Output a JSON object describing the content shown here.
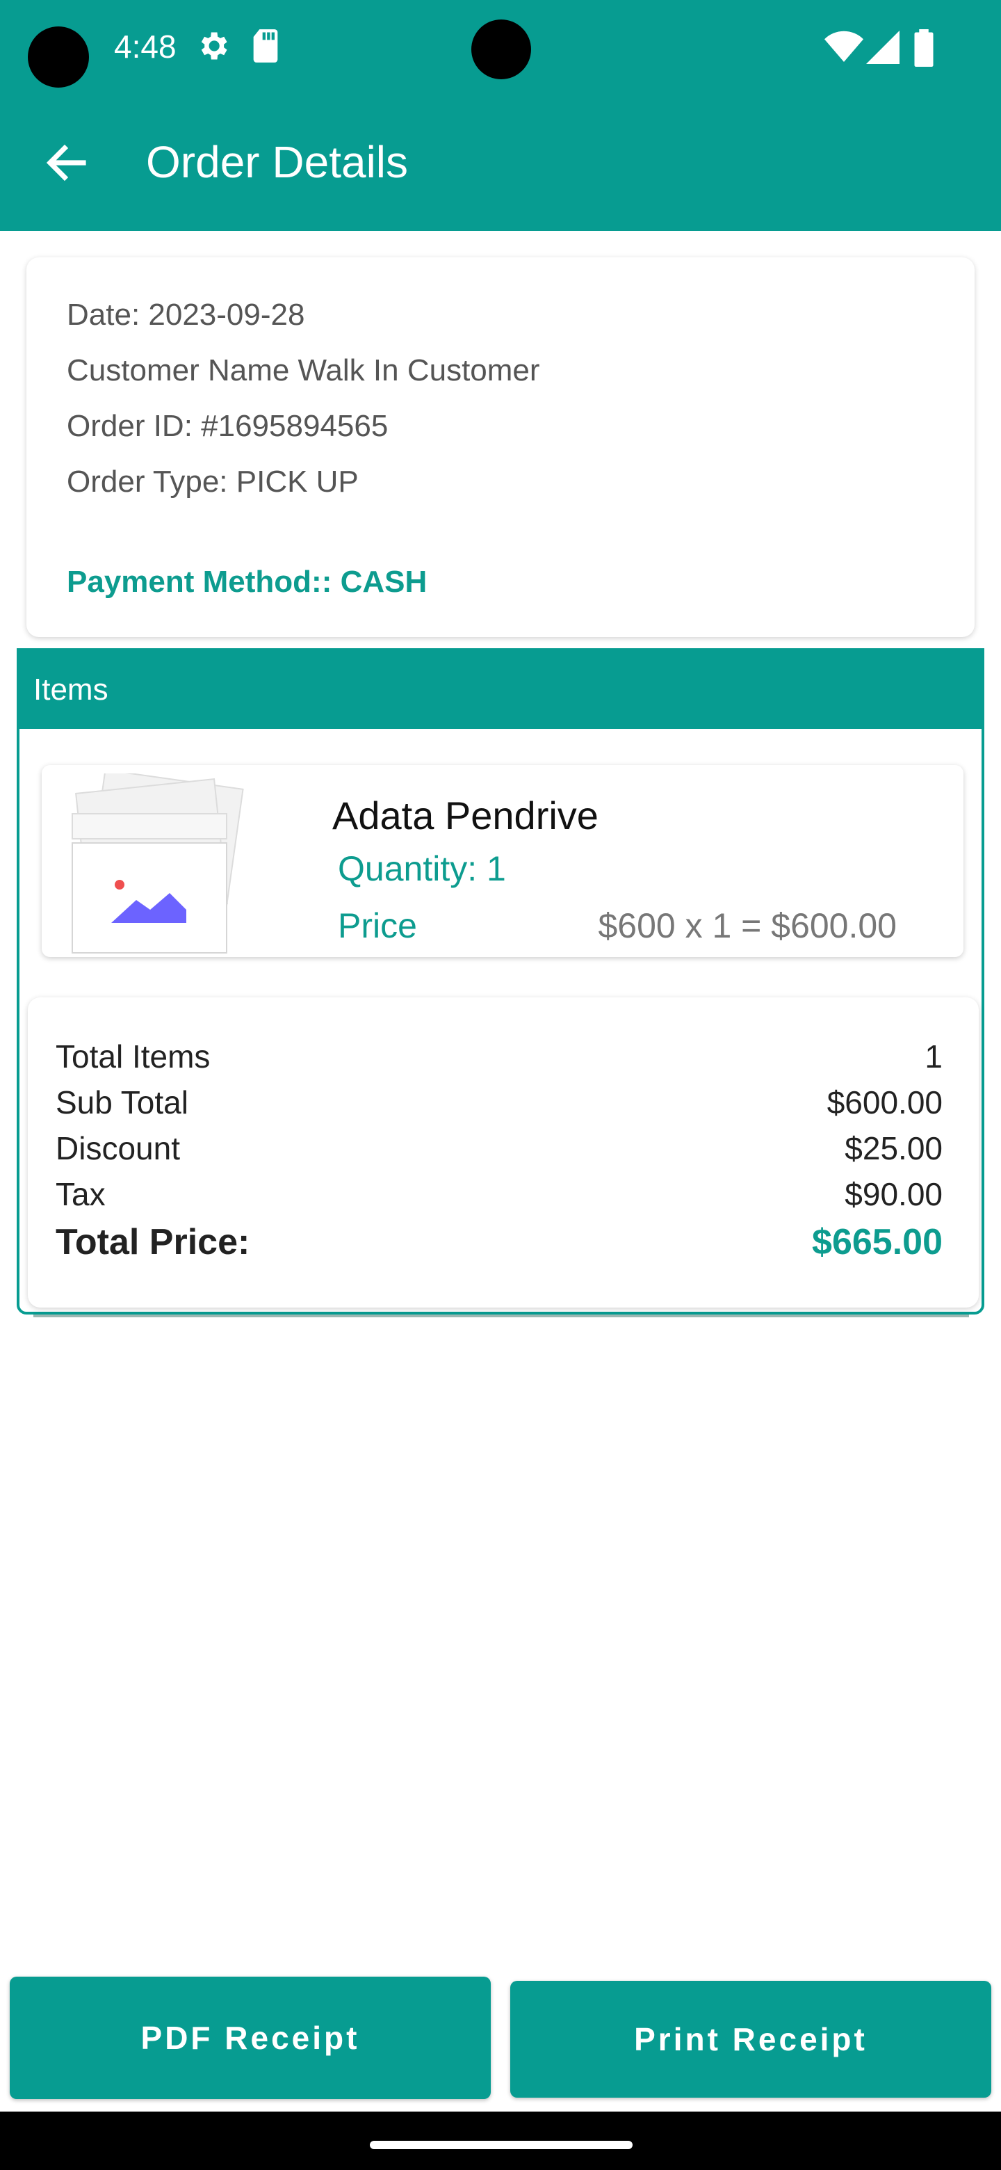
{
  "status_bar": {
    "time": "4:48",
    "icons": [
      "gear-icon",
      "sd-card-icon",
      "wifi-icon",
      "signal-icon",
      "battery-icon"
    ]
  },
  "app_bar": {
    "title": "Order Details",
    "back_icon": "arrow-left-icon"
  },
  "order_info": {
    "date": "Date: 2023-09-28",
    "customer": "Customer Name Walk In Customer",
    "order_id": "Order ID: #1695894565",
    "order_type": "Order Type: PICK UP",
    "payment_method": "Payment Method:: CASH"
  },
  "items_section": {
    "header": "Items",
    "items": [
      {
        "name": "Adata Pendrive",
        "quantity": "Quantity: 1",
        "price_label": "Price",
        "price_calc": "$600 x 1 = $600.00",
        "image_icon": "image-placeholder-icon"
      }
    ]
  },
  "summary": {
    "rows": [
      {
        "label": "Total Items",
        "value": "1"
      },
      {
        "label": "Sub Total",
        "value": "$600.00"
      },
      {
        "label": "Discount",
        "value": "$25.00"
      },
      {
        "label": "Tax",
        "value": "$90.00"
      }
    ],
    "total_label": "Total Price:",
    "total_value": "$665.00"
  },
  "actions": {
    "pdf_receipt": "PDF Receipt",
    "print_receipt": "Print Receipt"
  },
  "colors": {
    "primary": "#079c91",
    "accent_text": "#0d9c8f"
  }
}
